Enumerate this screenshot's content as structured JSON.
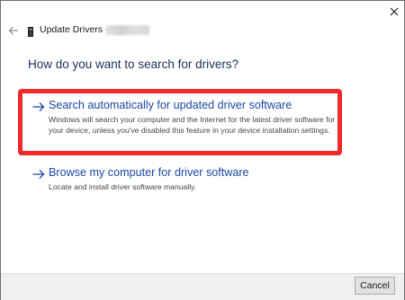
{
  "window": {
    "title": "Update Drivers -",
    "back_icon": "back-arrow-icon",
    "close_icon": "close-icon",
    "device_icon": "device-icon"
  },
  "main": {
    "heading": "How do you want to search for drivers?",
    "options": [
      {
        "icon": "arrow-right-icon",
        "title": "Search automatically for updated driver software",
        "description": "Windows will search your computer and the Internet for the latest driver software for your device, unless you've disabled this feature in your device installation settings.",
        "highlighted": true
      },
      {
        "icon": "arrow-right-icon",
        "title": "Browse my computer for driver software",
        "description": "Locate and install driver software manually.",
        "highlighted": false
      }
    ]
  },
  "footer": {
    "cancel_label": "Cancel"
  },
  "colors": {
    "link_blue": "#1b47a4",
    "heading_navy": "#1e2e57",
    "highlight_red": "#ee2a2a",
    "footer_gray": "#f0f0f0"
  }
}
